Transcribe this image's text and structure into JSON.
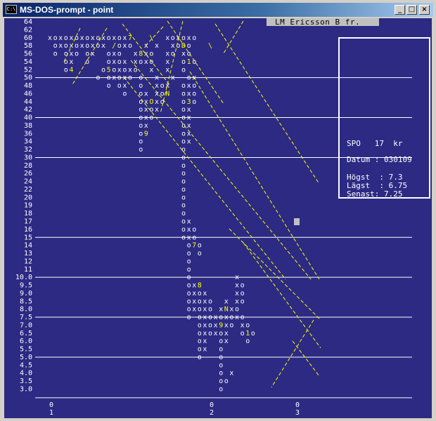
{
  "window": {
    "title": "MS-DOS-prompt - point",
    "icon_glyph": "C:\\",
    "minimize_glyph": "_",
    "maximize_glyph": "□",
    "close_glyph": "×",
    "icons": [
      "dos-prompt-icon",
      "minimize-icon",
      "maximize-icon",
      "close-icon"
    ]
  },
  "header": {
    "company": "LM Ericsson B fr."
  },
  "info": {
    "symbol_line": "SPO   17  kr",
    "date_line": "Datum : 030109",
    "high_line": "Högst  : 7.3",
    "low_line": "Lägst  : 6.75",
    "last_line": "Senast: 7.25"
  },
  "colors": {
    "background": "#2c2a83",
    "grid": "#ffffff",
    "symbols": "#ffffff",
    "trend": "#ffff00",
    "markers": "#ffff00"
  },
  "chart_data": {
    "type": "point-and-figure",
    "y_ticks": [
      "64",
      "62",
      "60",
      "58",
      "56",
      "54",
      "52",
      "50",
      "48",
      "46",
      "44",
      "42",
      "40",
      "38",
      "36",
      "34",
      "32",
      "30",
      "28",
      "26",
      "24",
      "22",
      "20",
      "19",
      "18",
      "17",
      "16",
      "15",
      "14",
      "13",
      "12",
      "11",
      "10.0",
      "9.5",
      "9.0",
      "8.5",
      "8.0",
      "7.5",
      "7.0",
      "6.5",
      "6.0",
      "5.5",
      "5.0",
      "4.5",
      "4.0",
      "3.5",
      "3.0"
    ],
    "grid_lines_at": [
      "50",
      "40",
      "30",
      "15",
      "10.0",
      "7.5",
      "5.0"
    ],
    "x_markers": [
      {
        "year": "0",
        "label": "1"
      },
      {
        "year": "0",
        "label": "2"
      },
      {
        "year": "0",
        "label": "3"
      }
    ],
    "rows": [
      {
        "price": "60",
        "text": "xoxoxoxoxoxoxox7   \\  xoxoxo"
      },
      {
        "price": "58",
        "text": " oxoxoxoxox /oxo  x x  xoDo   \\"
      },
      {
        "price": "56",
        "text": " o oxo ox  oxo  x8xo  xo xo"
      },
      {
        "price": "54",
        "text": "   ox  o   oxox xoxo  x  o1o"
      },
      {
        "price": "52",
        "text": "   o4     o5oxoxo  x  x  o"
      },
      {
        "price": "50",
        "text": "         o-oxoxo o  x  x  ox"
      },
      {
        "price": "48",
        "text": "           o ox  o  xox  oxo"
      },
      {
        "price": "46",
        "text": "              o  ox xoN  oxo"
      },
      {
        "price": "44",
        "text": "                 oxOxo   o3o"
      },
      {
        "price": "42",
        "text": "                 oxox    ox"
      },
      {
        "price": "40",
        "text": "                 oxo     ox"
      },
      {
        "price": "38",
        "text": "                 ox      ox"
      },
      {
        "price": "36",
        "text": "                 o9      ox"
      },
      {
        "price": "34",
        "text": "                 o       ox"
      },
      {
        "price": "32",
        "text": "                 o       o"
      },
      {
        "price": "30",
        "text": "                         o"
      },
      {
        "price": "28",
        "text": "                         o"
      },
      {
        "price": "26",
        "text": "                         o"
      },
      {
        "price": "24",
        "text": "                         o"
      },
      {
        "price": "22",
        "text": "                         o"
      },
      {
        "price": "20",
        "text": "                         o"
      },
      {
        "price": "19",
        "text": "                         o"
      },
      {
        "price": "18",
        "text": "                         o"
      },
      {
        "price": "17",
        "text": "                         ox"
      },
      {
        "price": "16",
        "text": "                         oxo"
      },
      {
        "price": "15",
        "text": "                         oxo"
      },
      {
        "price": "14",
        "text": "                          o7o"
      },
      {
        "price": "13",
        "text": "                          o o"
      },
      {
        "price": "12",
        "text": "                          o"
      },
      {
        "price": "11",
        "text": "                          o"
      },
      {
        "price": "10.0",
        "text": "                          o        x"
      },
      {
        "price": "9.5",
        "text": "                          ox8      xo"
      },
      {
        "price": "9.0",
        "text": "                          oxox     xo"
      },
      {
        "price": "8.5",
        "text": "                          oxoxo  x xo"
      },
      {
        "price": "8.0",
        "text": "                          oxoxo xNxo"
      },
      {
        "price": "7.5",
        "text": "                          o oxoxoxoxo"
      },
      {
        "price": "7.0",
        "text": "                            oxox9xo xo"
      },
      {
        "price": "6.5",
        "text": "                            oxoxox  o1o"
      },
      {
        "price": "6.0",
        "text": "                            ox  ox   o"
      },
      {
        "price": "5.5",
        "text": "                            ox  o"
      },
      {
        "price": "5.0",
        "text": "                            o   o"
      },
      {
        "price": "4.5",
        "text": "                                o"
      },
      {
        "price": "4.0",
        "text": "                                o x"
      },
      {
        "price": "3.5",
        "text": "                                oo"
      },
      {
        "price": "3.0",
        "text": "                                o"
      }
    ]
  }
}
